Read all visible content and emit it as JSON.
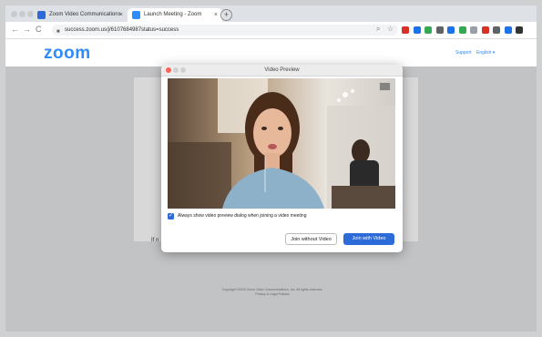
{
  "browser": {
    "tabs": [
      {
        "label": "Zoom Video Communications",
        "icon_color": "#2d6bd9",
        "active": false
      },
      {
        "label": "Launch Meeting - Zoom",
        "icon_color": "#2d8cff",
        "active": true
      }
    ],
    "tab_close_glyph": "×",
    "new_tab_glyph": "+",
    "address": "success.zoom.us/j/6107684987status=success",
    "nav": {
      "back": "←",
      "forward": "→",
      "reload": "C"
    },
    "extension_colors": [
      "#d93025",
      "#1a73e8",
      "#34a853",
      "#5f6368",
      "#1a73e8",
      "#34a853",
      "#9aa0a6",
      "#d93025",
      "#5f6368",
      "#1a73e8",
      "#333333"
    ]
  },
  "zoom_page": {
    "logo": "zoom",
    "support_link": "Support",
    "language_link": "English ▾",
    "partial_text": "If n",
    "footer_line1": "Copyright ©2020 Zoom Video Communications, Inc. All rights reserved.",
    "footer_line2": "Privacy & Legal Policies"
  },
  "dialog": {
    "title": "Video Preview",
    "checkbox_label": "Always show video preview dialog when joining a video meeting",
    "checkbox_checked": true,
    "checkbox_glyph": "✓",
    "join_without_video": "Join without Video",
    "join_with_video": "Join with Video"
  },
  "colors": {
    "zoom_blue": "#2d8cff",
    "primary_button": "#2d6bd9"
  }
}
